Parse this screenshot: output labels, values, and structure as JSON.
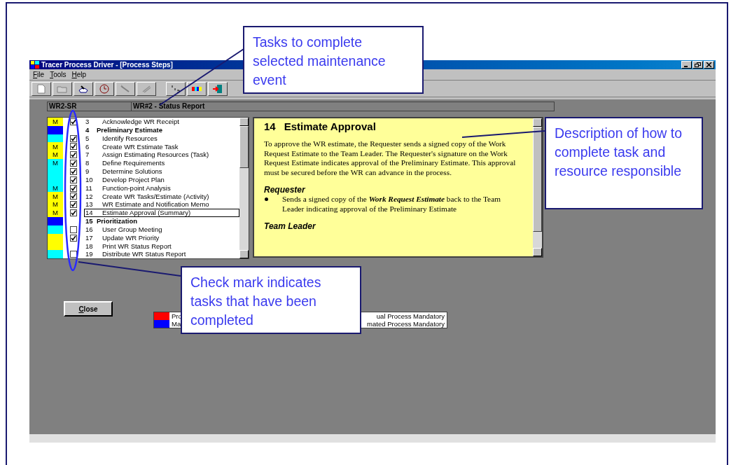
{
  "window": {
    "title": "Tracer Process Driver - [Process Steps]",
    "menu": [
      "File",
      "Tools",
      "Help"
    ],
    "header": {
      "code": "WR2-SR",
      "title": "WR#2 - Status Report"
    },
    "tasks": [
      {
        "kind": "task",
        "color": "#ffff00",
        "mark": "M",
        "checked": true,
        "number": "3",
        "label": "Acknowledge WR Receipt",
        "selected": false
      },
      {
        "kind": "header",
        "color": "#0000ff",
        "number": "4",
        "label": "Preliminary Estimate",
        "selected": false
      },
      {
        "kind": "task",
        "color": "#00ffff",
        "checked": true,
        "number": "5",
        "label": "Identify Resources",
        "selected": false
      },
      {
        "kind": "task",
        "color": "#ffff00",
        "mark": "M",
        "checked": true,
        "number": "6",
        "label": "Create WR Estimate Task",
        "selected": false
      },
      {
        "kind": "task",
        "color": "#ffff00",
        "mark": "M",
        "checked": true,
        "number": "7",
        "label": "Assign Estimating Resources (Task)",
        "selected": false
      },
      {
        "kind": "task",
        "color": "#00ffff",
        "mark": "M",
        "checked": true,
        "number": "8",
        "label": "Define Requirements",
        "selected": false
      },
      {
        "kind": "task",
        "color": "#00ffff",
        "checked": true,
        "number": "9",
        "label": "Determine Solutions",
        "selected": false
      },
      {
        "kind": "task",
        "color": "#00ffff",
        "checked": true,
        "number": "10",
        "label": "Develop Project Plan",
        "selected": false
      },
      {
        "kind": "task",
        "color": "#00ffff",
        "mark": "M",
        "checked": true,
        "number": "11",
        "label": "Function-point Analysis",
        "selected": false
      },
      {
        "kind": "task",
        "color": "#ffff00",
        "mark": "M",
        "checked": true,
        "number": "12",
        "label": "Create WR Tasks/Estimate (Activity)",
        "selected": false
      },
      {
        "kind": "task",
        "color": "#ffff00",
        "mark": "M",
        "checked": true,
        "number": "13",
        "label": "WR Estimate and Notification Memo",
        "selected": false
      },
      {
        "kind": "task",
        "color": "#ffff00",
        "mark": "M",
        "checked": true,
        "number": "14",
        "label": "Estimate Approval (Summary)",
        "selected": true
      },
      {
        "kind": "header",
        "color": "#0000ff",
        "number": "15",
        "label": "Prioritization",
        "selected": false
      },
      {
        "kind": "task",
        "color": "#00ffff",
        "checked": false,
        "number": "16",
        "label": "User Group Meeting",
        "selected": false
      },
      {
        "kind": "task",
        "color": "#ffff00",
        "checked": true,
        "number": "17",
        "label": "Update WR Priority",
        "selected": false
      },
      {
        "kind": "note",
        "color": "#ffff00",
        "number": "18",
        "label": "Print WR Status Report",
        "selected": false
      },
      {
        "kind": "task",
        "color": "#00ffff",
        "checked": false,
        "number": "19",
        "label": "Distribute WR Status Report",
        "selected": false
      }
    ],
    "description": {
      "number": "14",
      "heading": "Estimate Approval",
      "intro": "To approve the WR estimate, the Requester sends a signed copy of the Work Request Estimate to the Team Leader. The Requester's signature on the Work Request Estimate indicates approval of the Preliminary Estimate. This approval must be secured before the WR can advance in the process.",
      "sections": [
        {
          "role": "Requester",
          "bullets": [
            "Sends a signed copy of the **Work Request Estimate** back to the Team Leader indicating approval of the Preliminary Estimate"
          ]
        },
        {
          "role": "Team Leader"
        }
      ]
    },
    "close_button": "Close",
    "legend": [
      {
        "color": "#ff0000",
        "left": "Pro",
        "right": "ual Process Mandatory"
      },
      {
        "color": "#0000ff",
        "left": "Ma",
        "right": "mated Process Mandatory"
      }
    ]
  },
  "callouts": [
    {
      "text": "Tasks to complete selected maintenance event"
    },
    {
      "text": "Description of how to complete task and resource responsible"
    },
    {
      "text": "Check mark indicates tasks that have been completed"
    }
  ]
}
